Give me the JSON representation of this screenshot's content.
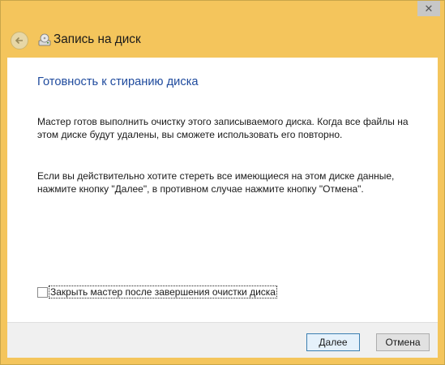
{
  "window": {
    "close_glyph": "✕"
  },
  "header": {
    "back_icon": "back-arrow-icon",
    "app_icon": "disc-burn-icon",
    "title": "Запись на диск"
  },
  "main": {
    "heading": "Готовность к стиранию диска",
    "paragraph1": "Мастер готов выполнить очистку этого записываемого диска. Когда все файлы на этом диске будут удалены, вы сможете использовать его повторно.",
    "paragraph2": "Если вы действительно хотите стереть все имеющиеся на этом диске данные, нажмите кнопку \"Далее\", в противном случае нажмите кнопку \"Отмена\".",
    "checkbox": {
      "label": "Закрыть мастер после завершения очистки диска",
      "checked": false
    }
  },
  "footer": {
    "next_label": "Далее",
    "cancel_label": "Отмена"
  },
  "colors": {
    "frame": "#f4c55c",
    "heading": "#1e4a9d",
    "content_bg": "#ffffff"
  }
}
